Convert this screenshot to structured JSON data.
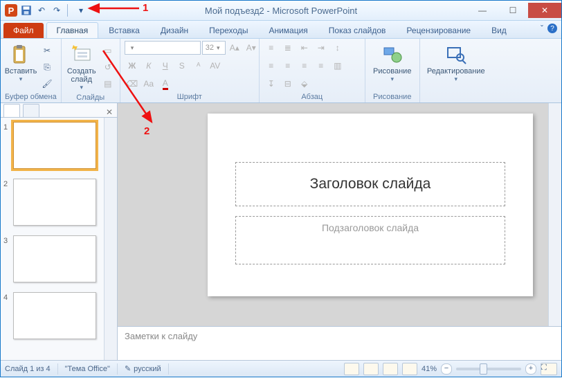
{
  "title": "Мой подъезд2 - Microsoft PowerPoint",
  "qat": {
    "undo": "↶",
    "redo": "↷"
  },
  "file_tab": "Файл",
  "tabs": [
    "Главная",
    "Вставка",
    "Дизайн",
    "Переходы",
    "Анимация",
    "Показ слайдов",
    "Рецензирование",
    "Вид"
  ],
  "active_tab": 0,
  "ribbon": {
    "clipboard": {
      "paste": "Вставить",
      "label": "Буфер обмена"
    },
    "slides": {
      "new_slide": "Создать\nслайд",
      "label": "Слайды"
    },
    "font": {
      "label": "Шрифт",
      "size": "32"
    },
    "paragraph": {
      "label": "Абзац"
    },
    "drawing": {
      "label": "Рисование",
      "btn": "Рисование"
    },
    "editing": {
      "label": "",
      "btn": "Редактирование"
    }
  },
  "thumbs": {
    "count": 4,
    "selected": 1
  },
  "slide": {
    "title_ph": "Заголовок слайда",
    "subtitle_ph": "Подзаголовок слайда"
  },
  "notes_placeholder": "Заметки к слайду",
  "status": {
    "slide": "Слайд 1 из 4",
    "theme": "\"Тема Office\"",
    "lang": "русский",
    "zoom": "41%"
  },
  "annotations": {
    "a1": "1",
    "a2": "2"
  },
  "colors": {
    "accent": "#ce3c12",
    "ribbon": "#eaf2fb"
  }
}
